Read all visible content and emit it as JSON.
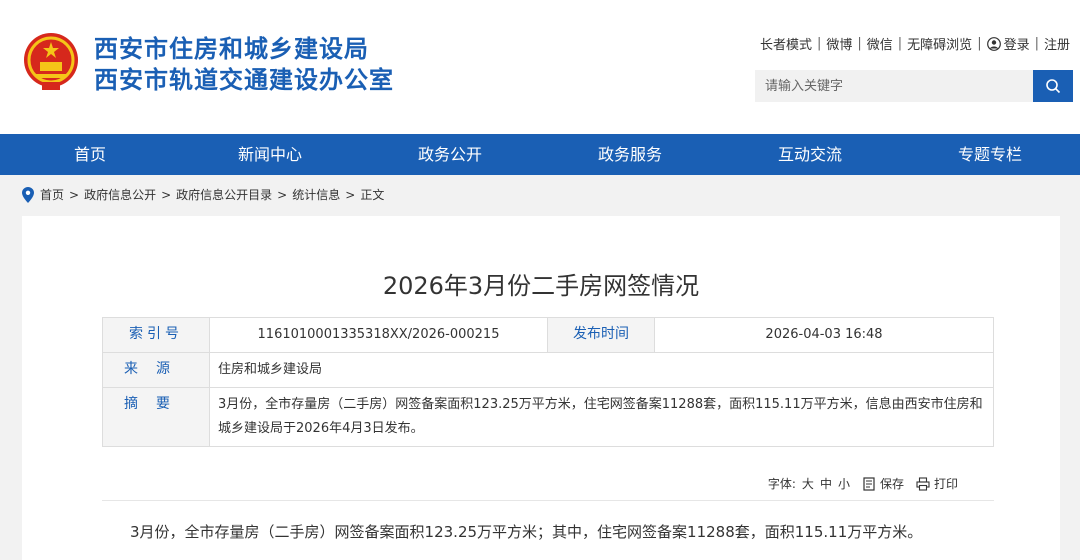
{
  "header": {
    "title_line1": "西安市住房和城乡建设局",
    "title_line2": "西安市轨道交通建设办公室",
    "brand_color": "#1a5fb4",
    "top_links": [
      "长者模式",
      "微博",
      "微信",
      "无障碍浏览"
    ],
    "login_label": "登录",
    "register_label": "注册",
    "search_placeholder": "请输入关键字"
  },
  "nav": {
    "items": [
      "首页",
      "新闻中心",
      "政务公开",
      "政务服务",
      "互动交流",
      "专题专栏"
    ]
  },
  "breadcrumb": {
    "items": [
      "首页",
      "政府信息公开",
      "政府信息公开目录",
      "统计信息",
      "正文"
    ],
    "separator": ">"
  },
  "article": {
    "title": "2026年3月份二手房网签情况",
    "meta": {
      "index_label": "索引号",
      "index_value": "1161010001335318XX/2026-000215",
      "date_label": "发布时间",
      "date_value": "2026-04-03 16:48",
      "source_label": "来源",
      "source_value": "住房和城乡建设局",
      "summary_label": "摘要",
      "summary_value": "3月份，全市存量房（二手房）网签备案面积123.25万平方米，住宅网签备案11288套，面积115.11万平方米，信息由西安市住房和城乡建设局于2026年4月3日发布。"
    },
    "tools": {
      "font_label": "字体:",
      "sizes": [
        "大",
        "中",
        "小"
      ],
      "save_label": "保存",
      "print_label": "打印"
    },
    "body": "3月份，全市存量房（二手房）网签备案面积123.25万平方米；其中，住宅网签备案11288套，面积115.11万平方米。"
  },
  "icons": [
    "national-emblem-icon",
    "user-icon",
    "search-icon",
    "location-pin-icon",
    "save-icon",
    "print-icon"
  ]
}
